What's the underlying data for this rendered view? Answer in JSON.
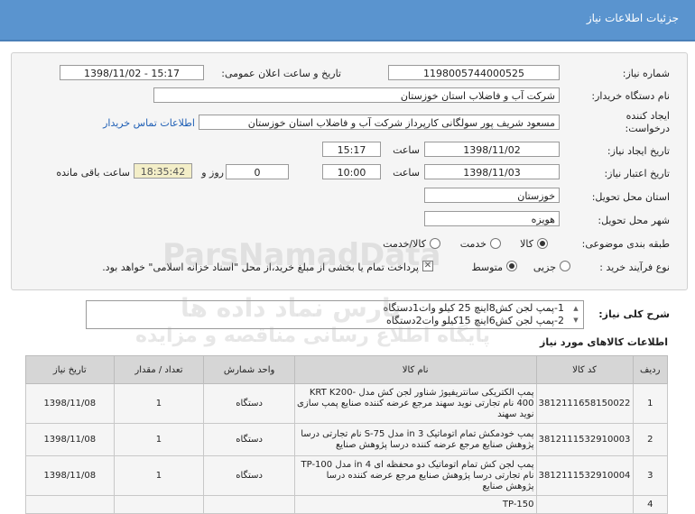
{
  "header": {
    "title": "جزئیات اطلاعات نیاز"
  },
  "form": {
    "need_number_label": "شماره نیاز:",
    "need_number": "1198005744000525",
    "announce_label": "تاریخ و ساعت اعلان عمومی:",
    "announce_value": "1398/11/02 - 15:17",
    "buyer_label": "نام دستگاه خریدار:",
    "buyer": "شرکت آب و فاضلاب استان خوزستان",
    "creator_label_1": "ایجاد کننده",
    "creator_label_2": "درخواست:",
    "creator": "مسعود شریف پور سولگانی کارپرداز شرکت آب و فاضلاب استان خوزستان",
    "contact_link": "اطلاعات تماس خریدار",
    "created_date_label": "تاریخ ایجاد نیاز:",
    "created_date": "1398/11/02",
    "time_label": "ساعت",
    "created_time": "15:17",
    "validity_label": "تاریخ اعتبار نیاز:",
    "validity_date": "1398/11/03",
    "validity_time": "10:00",
    "days_value": "0",
    "days_label": "روز و",
    "remaining_time": "18:35:42",
    "remaining_label": "ساعت باقی مانده",
    "province_label": "استان محل تحویل:",
    "province": "خوزستان",
    "city_label": "شهر محل تحویل:",
    "city": "هویزه",
    "category_label": "طبقه بندی موضوعی:",
    "category_options": [
      "کالا",
      "خدمت",
      "کالا/خدمت"
    ],
    "category_selected": "کالا",
    "process_label": "نوع فرآیند خرید :",
    "process_options": [
      "جزیی",
      "متوسط"
    ],
    "process_selected": "متوسط",
    "payment_note": "پرداخت تمام یا بخشی از مبلغ خرید،از محل \"اسناد خزانه اسلامی\" خواهد بود.",
    "description_label": "شرح کلی نیاز:",
    "description_lines": [
      "1-پمپ لجن کش8اینچ 25 کیلو وات1دستگاه",
      "2-پمپ لجن کش6اینچ 15کیلو وات2دستگاه"
    ]
  },
  "watermark": {
    "line1": "ParsNamadData",
    "line2": "پارس نماد داده ها",
    "line3": "پایگاه اطلاع رسانی مناقصه و مزایده"
  },
  "items_section_title": "اطلاعات کالاهای مورد نیاز",
  "table": {
    "headers": [
      "ردیف",
      "کد کالا",
      "نام کالا",
      "واحد شمارش",
      "تعداد / مقدار",
      "تاریخ نیاز"
    ],
    "rows": [
      {
        "row": "1",
        "code": "3812111658150022",
        "name": "پمپ الکتریکی سانتریفیوژ شناور لجن کش مدل KRT K200-400 نام تجارتی نوید سهند مرجع عرضه کننده صنایع پمپ سازی نوید سهند",
        "unit": "دستگاه",
        "qty": "1",
        "date": "1398/11/08"
      },
      {
        "row": "2",
        "code": "3812111532910003",
        "name": "پمپ خودمکش تمام اتوماتیک 3 in مدل S-75 نام تجارتی درسا پژوهش صنایع مرجع عرضه کننده درسا پژوهش صنایع",
        "unit": "دستگاه",
        "qty": "1",
        "date": "1398/11/08"
      },
      {
        "row": "3",
        "code": "3812111532910004",
        "name": "پمپ لجن کش تمام اتوماتیک دو محفظه ای 4 in مدل TP-100 نام تجارتی درسا پژوهش صنایع مرجع عرضه کننده درسا پژوهش صنایع",
        "unit": "دستگاه",
        "qty": "1",
        "date": "1398/11/08"
      },
      {
        "row": "4",
        "code": "",
        "name": "TP-150",
        "unit": "",
        "qty": "",
        "date": ""
      }
    ]
  }
}
